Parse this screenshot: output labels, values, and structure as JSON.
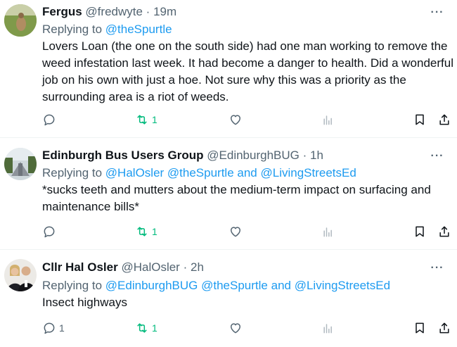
{
  "tweets": [
    {
      "name": "Fergus",
      "handle": "@fredwyte",
      "sep": "·",
      "time": "19m",
      "replying_label": "Replying to",
      "replying_to": [
        "@theSpurtle"
      ],
      "replying_joiner": "",
      "body": "Lovers Loan (the one on the south side) had one man working to remove the weed infestation last week. It had become a danger to health. Did a wonderful job on his own with just a hoe. Not sure why this was a priority as the surrounding area is a riot of weeds.",
      "reply_count": "",
      "retweet_count": "1",
      "like_count": ""
    },
    {
      "name": "Edinburgh Bus Users Group",
      "handle": "@EdinburghBUG",
      "sep": "·",
      "time": "1h",
      "replying_label": "Replying to",
      "replying_to": [
        "@HalOsler @theSpurtle",
        "@LivingStreetsEd"
      ],
      "replying_joiner": "and",
      "body": "*sucks teeth and mutters about the medium-term impact on surfacing and maintenance bills*",
      "reply_count": "",
      "retweet_count": "1",
      "like_count": ""
    },
    {
      "name": "Cllr Hal Osler",
      "handle": "@HalOsler",
      "sep": "·",
      "time": "2h",
      "replying_label": "Replying to",
      "replying_to": [
        "@EdinburghBUG @theSpurtle",
        "@LivingStreetsEd"
      ],
      "replying_joiner": "and",
      "body": "Insect highways",
      "reply_count": "1",
      "retweet_count": "1",
      "like_count": ""
    }
  ],
  "icons": {
    "reply": "reply-icon",
    "retweet": "retweet-icon",
    "like": "heart-icon",
    "views": "views-icon",
    "bookmark": "bookmark-icon",
    "share": "share-icon",
    "more": "more-icon"
  },
  "colors": {
    "link": "#1d9bf0",
    "retweet_green": "#00ba7c",
    "secondary": "#536471"
  }
}
